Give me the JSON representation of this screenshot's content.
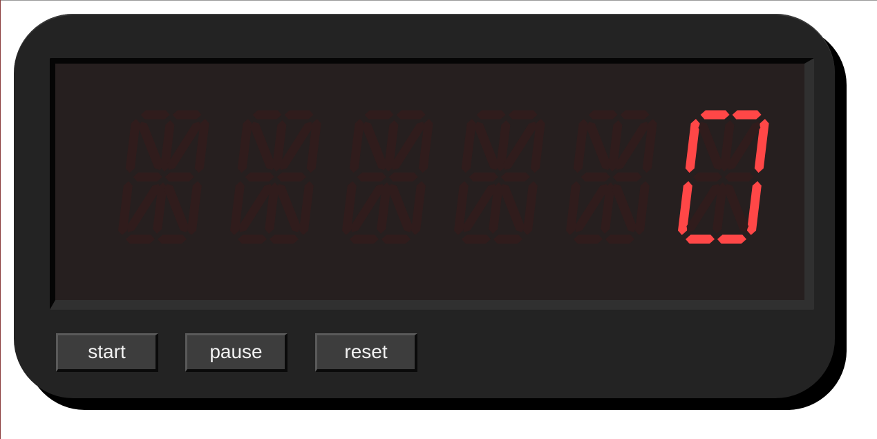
{
  "display": {
    "value": "0",
    "digit_count": 6,
    "lit_color": "#ff4747",
    "unlit_color": "#301c1c",
    "background_color": "#261f1f"
  },
  "controls": {
    "start_label": "start",
    "pause_label": "pause",
    "reset_label": "reset"
  }
}
